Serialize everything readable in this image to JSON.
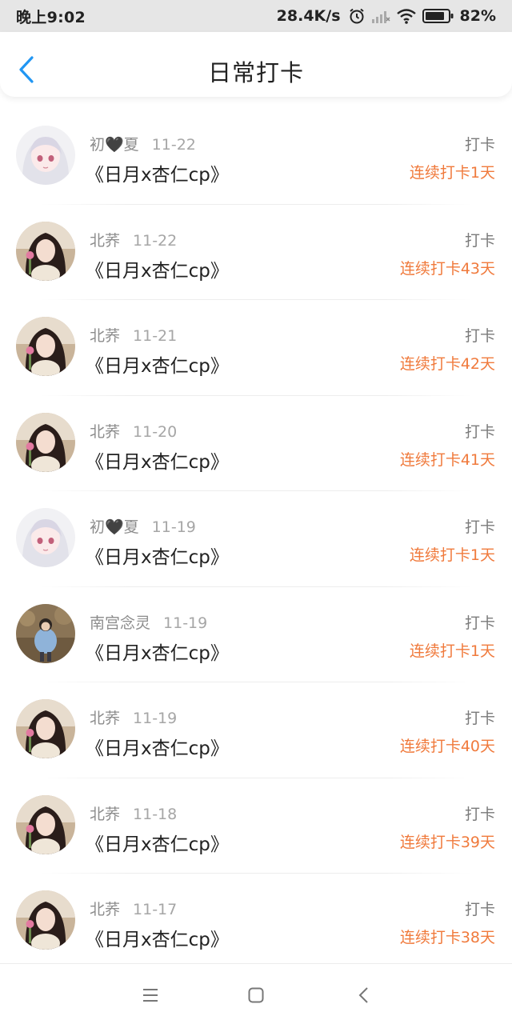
{
  "status_bar": {
    "time": "晚上9:02",
    "network_speed": "28.4K/s",
    "battery": "82%",
    "icons": [
      "alarm-icon",
      "signal-icon",
      "wifi-icon",
      "battery-icon"
    ]
  },
  "header": {
    "title": "日常打卡",
    "back_icon": "chevron-left-icon"
  },
  "colors": {
    "accent": "#2196f3",
    "streak": "#f07a3c",
    "meta": "#8c8c8c"
  },
  "checkins": [
    {
      "user": "初🖤夏",
      "date": "11-22",
      "topic": "《日月x杏仁cp》",
      "type": "打卡",
      "streak": "连续打卡1天",
      "avatar": "anime-girl"
    },
    {
      "user": "北荞",
      "date": "11-22",
      "topic": "《日月x杏仁cp》",
      "type": "打卡",
      "streak": "连续打卡43天",
      "avatar": "girl-photo"
    },
    {
      "user": "北荞",
      "date": "11-21",
      "topic": "《日月x杏仁cp》",
      "type": "打卡",
      "streak": "连续打卡42天",
      "avatar": "girl-photo"
    },
    {
      "user": "北荞",
      "date": "11-20",
      "topic": "《日月x杏仁cp》",
      "type": "打卡",
      "streak": "连续打卡41天",
      "avatar": "girl-photo"
    },
    {
      "user": "初🖤夏",
      "date": "11-19",
      "topic": "《日月x杏仁cp》",
      "type": "打卡",
      "streak": "连续打卡1天",
      "avatar": "anime-girl"
    },
    {
      "user": "南宫念灵",
      "date": "11-19",
      "topic": "《日月x杏仁cp》",
      "type": "打卡",
      "streak": "连续打卡1天",
      "avatar": "outdoor-photo"
    },
    {
      "user": "北荞",
      "date": "11-19",
      "topic": "《日月x杏仁cp》",
      "type": "打卡",
      "streak": "连续打卡40天",
      "avatar": "girl-photo"
    },
    {
      "user": "北荞",
      "date": "11-18",
      "topic": "《日月x杏仁cp》",
      "type": "打卡",
      "streak": "连续打卡39天",
      "avatar": "girl-photo"
    },
    {
      "user": "北荞",
      "date": "11-17",
      "topic": "《日月x杏仁cp》",
      "type": "打卡",
      "streak": "连续打卡38天",
      "avatar": "girl-photo"
    }
  ],
  "nav_bar": {
    "icons": [
      "menu-icon",
      "home-square-icon",
      "back-triangle-icon"
    ]
  }
}
